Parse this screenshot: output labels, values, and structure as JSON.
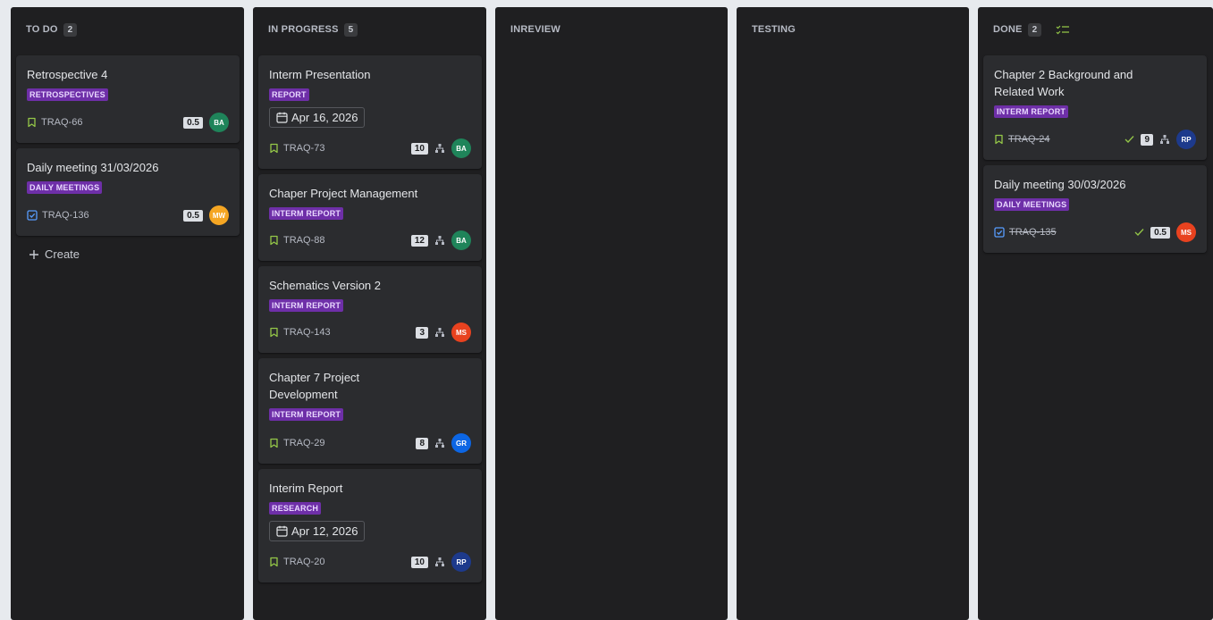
{
  "colors": {
    "story": "#94c748",
    "task": "#579dff",
    "label_bg": "#6e2fa8",
    "done_check": "#94c748",
    "avatar_BA": "#1f845a",
    "avatar_MW": "#f5a623",
    "avatar_MS": "#e8421f",
    "avatar_GR": "#0c66e4",
    "avatar_RP": "#1d3a8c"
  },
  "columns": [
    {
      "name": "TO DO",
      "count": "2",
      "create_label": "Create",
      "cards": [
        {
          "title": "Retrospective 4",
          "label": "RETROSPECTIVES",
          "type": "story-icon",
          "key": "TRAQ-66",
          "points": "0.5",
          "avatar": "BA"
        },
        {
          "title": "Daily meeting 31/03/2026",
          "label": "DAILY MEETINGS",
          "type": "task-icon",
          "key": "TRAQ-136",
          "points": "0.5",
          "avatar": "MW"
        }
      ]
    },
    {
      "name": "IN PROGRESS",
      "count": "5",
      "cards": [
        {
          "title": "Interm Presentation",
          "label": "REPORT",
          "date": "Apr 16, 2026",
          "type": "story-icon",
          "key": "TRAQ-73",
          "points": "10",
          "avatar": "BA"
        },
        {
          "title": "Chaper Project Management",
          "label": "INTERM REPORT",
          "type": "story-icon",
          "key": "TRAQ-88",
          "points": "12",
          "avatar": "BA"
        },
        {
          "title": "Schematics Version 2",
          "label": "INTERM REPORT",
          "type": "story-icon",
          "key": "TRAQ-143",
          "points": "3",
          "avatar": "MS"
        },
        {
          "title_lines": [
            "Chapter 7 Project",
            "Development"
          ],
          "label": "INTERM REPORT",
          "type": "story-icon",
          "key": "TRAQ-29",
          "points": "8",
          "avatar": "GR"
        },
        {
          "title": "Interim Report",
          "label": "RESEARCH",
          "date": "Apr 12, 2026",
          "type": "story-icon",
          "key": "TRAQ-20",
          "points": "10",
          "avatar": "RP"
        }
      ]
    },
    {
      "name": "INREVIEW",
      "cards": []
    },
    {
      "name": "TESTING",
      "cards": []
    },
    {
      "name": "DONE",
      "count": "2",
      "cards": [
        {
          "title_lines": [
            "Chapter 2 Background and",
            "Related Work"
          ],
          "label": "INTERM REPORT",
          "type": "story-icon",
          "key": "TRAQ-24",
          "points": "9",
          "avatar": "RP"
        },
        {
          "title": "Daily meeting 30/03/2026",
          "label": "DAILY MEETINGS",
          "type": "task-icon",
          "key": "TRAQ-135",
          "points": "0.5",
          "avatar": "MS"
        }
      ]
    }
  ]
}
